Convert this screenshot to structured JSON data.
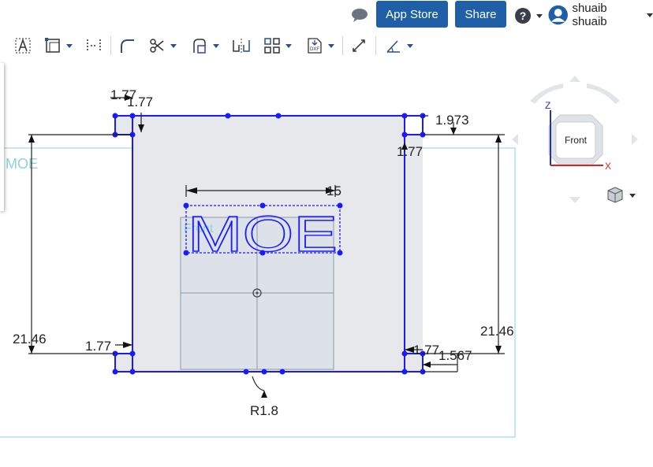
{
  "topbar": {
    "comments_icon": "speech-bubble-icon",
    "app_store_label": "App Store",
    "share_label": "Share",
    "help_icon": "question-circle-icon",
    "user_name": "shuaib shuaib"
  },
  "toolbar": {
    "tools": [
      "text-icon",
      "rectangle-icon",
      "midpoint-line-icon",
      "fillet-icon",
      "trim-icon",
      "offset-icon",
      "mirror-icon",
      "pattern-icon",
      "dxf-import-icon",
      "dimension-icon",
      "constraint-icon"
    ]
  },
  "view_cube": {
    "face_label": "Front",
    "z_label": "Z",
    "x_label": "X"
  },
  "sketch": {
    "plane_label": "MOE",
    "front_plane_label": "Front",
    "text_entity": "MOE",
    "dimensions": {
      "top_left_a": "1.77",
      "top_left_b": "1.77",
      "top_right_a": "1.973",
      "top_right_b": "1.77",
      "text_width": "15",
      "left_height": "21.46",
      "right_height": "21.46",
      "bottom_left": "1.77",
      "bottom_right_a": "1.77",
      "bottom_right_b": "1.567",
      "radius": "R1.8"
    }
  },
  "colors": {
    "accent": "#1f5fa8",
    "sketch_line": "#1a1aff",
    "plane": "#8ecfe8",
    "fill": "#e6e8ec"
  }
}
